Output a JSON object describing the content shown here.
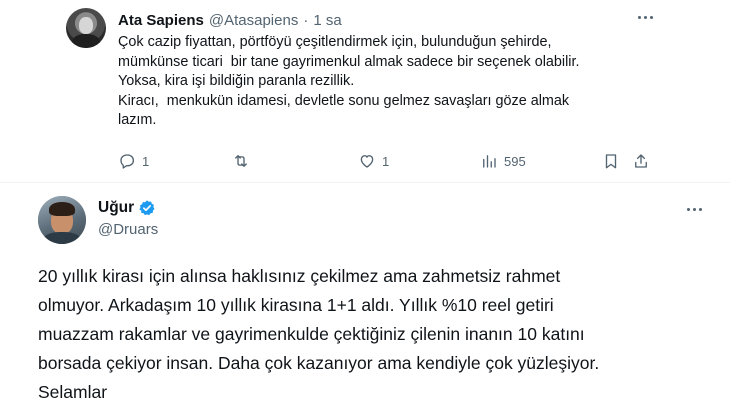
{
  "parent_tweet": {
    "author_name": "Ata Sapiens",
    "author_handle": "@Atasapiens",
    "separator": "·",
    "time": "1 sa",
    "text_lines": [
      "Çok cazip fiyattan, pörtföyü çeşitlendirmek için, bulunduğun şehirde,",
      "mümkünse ticari  bir tane gayrimenkul almak sadece bir seçenek olabilir.",
      "Yoksa, kira işi bildiğin paranla rezillik.",
      "Kiracı,  menkukün idamesi, devletle sonu gelmez savaşları göze almak",
      "lazım."
    ],
    "actions": {
      "reply_count": "1",
      "retweet_count": "",
      "like_count": "1",
      "view_count": "595"
    },
    "icons": [
      "reply-icon",
      "retweet-icon",
      "like-icon",
      "views-icon",
      "bookmark-icon",
      "share-icon",
      "more-icon"
    ]
  },
  "main_tweet": {
    "author_name": "Uğur",
    "author_handle": "@Druars",
    "verified": true,
    "text_lines": [
      "20 yıllık kirası için alınsa haklısınız çekilmez ama zahmetsiz rahmet",
      "olmuyor. Arkadaşım 10 yıllık kirasına 1+1 aldı. Yıllık %10 reel getiri",
      "muazzam rakamlar ve gayrimenkulde çektiğiniz çilenin inanın 10 katını",
      "borsada çekiyor insan. Daha çok kazanıyor ama kendiyle çok yüzleşiyor.",
      "Selamlar"
    ]
  },
  "colors": {
    "text_primary": "#0f1419",
    "text_secondary": "#536471",
    "verified_blue": "#1d9bf0",
    "divider": "#eff3f4"
  }
}
